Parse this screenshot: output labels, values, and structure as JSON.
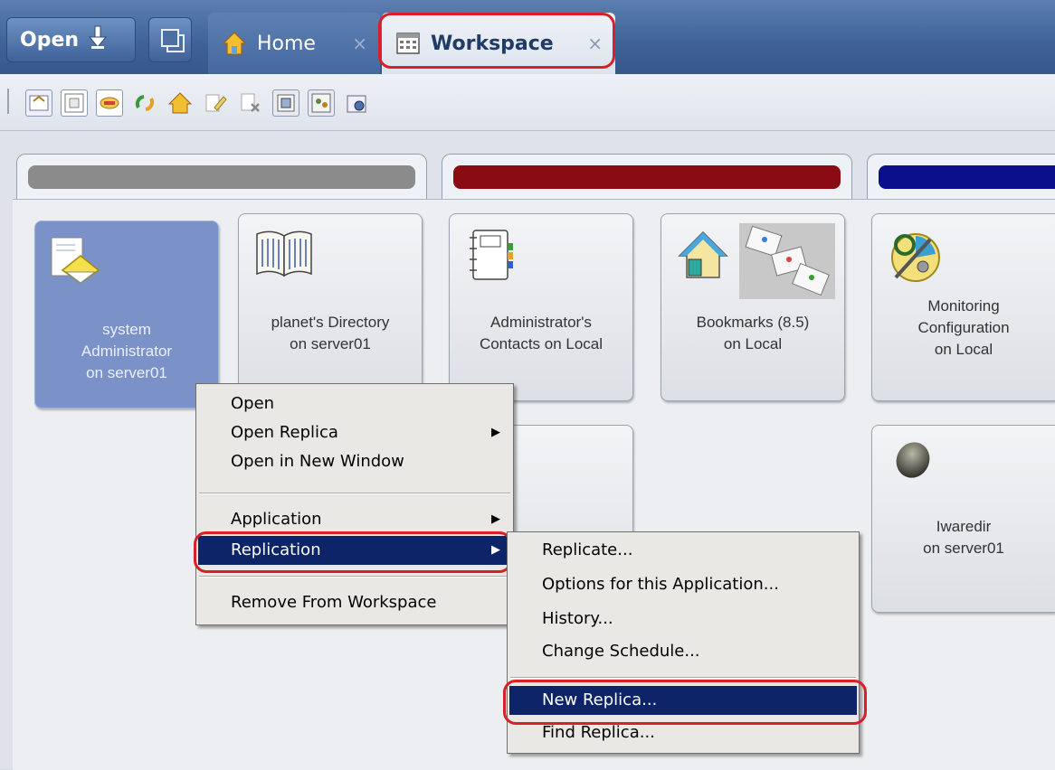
{
  "top_bar": {
    "open_label": "Open",
    "tabs": [
      {
        "label": "Home",
        "close": "×"
      },
      {
        "label": "Workspace",
        "close": "×"
      }
    ]
  },
  "toolbar": {
    "icons": [
      "workspace-icon",
      "properties-icon",
      "key-icon",
      "refresh-icon",
      "home-icon",
      "edit-icon",
      "remove-icon",
      "stack-icon",
      "group-icon",
      "settings-icon"
    ]
  },
  "page_tabs": {
    "colors": [
      "#8b8b8b",
      "#8a0b12",
      "#0a0f8c"
    ]
  },
  "tiles": [
    {
      "line1": "system",
      "line2": "Administrator",
      "line3": "on server01"
    },
    {
      "line1": "planet's Directory",
      "line2": "on server01"
    },
    {
      "line1": "Administrator's",
      "line2": "Contacts on Local"
    },
    {
      "line1": "Bookmarks (8.5)",
      "line2": "on Local"
    },
    {
      "line1": "Monitoring",
      "line2": "Configuration",
      "line3": "on Local"
    },
    {
      "line1": "Iwaredir",
      "line2": "on server01"
    }
  ],
  "context_menu": {
    "items": [
      "Open",
      "Open Replica",
      "Open in New Window",
      "Application",
      "Replication",
      "Remove From Workspace"
    ],
    "submenu_arrow": "▶"
  },
  "replication_submenu": {
    "items": [
      "Replicate...",
      "Options for this Application...",
      "History...",
      "Change Schedule...",
      "New Replica...",
      "Find Replica..."
    ]
  },
  "accent": {
    "highlight": "#d9202a",
    "selection": "#0d2568",
    "title_bar": "#3f6296"
  }
}
